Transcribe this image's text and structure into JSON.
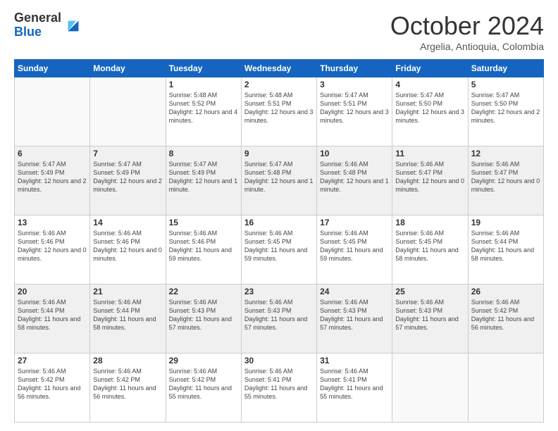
{
  "logo": {
    "line1": "General",
    "line2": "Blue"
  },
  "title": "October 2024",
  "subtitle": "Argelia, Antioquia, Colombia",
  "days_of_week": [
    "Sunday",
    "Monday",
    "Tuesday",
    "Wednesday",
    "Thursday",
    "Friday",
    "Saturday"
  ],
  "weeks": [
    [
      {
        "day": "",
        "info": ""
      },
      {
        "day": "",
        "info": ""
      },
      {
        "day": "1",
        "info": "Sunrise: 5:48 AM\nSunset: 5:52 PM\nDaylight: 12 hours and 4 minutes."
      },
      {
        "day": "2",
        "info": "Sunrise: 5:48 AM\nSunset: 5:51 PM\nDaylight: 12 hours and 3 minutes."
      },
      {
        "day": "3",
        "info": "Sunrise: 5:47 AM\nSunset: 5:51 PM\nDaylight: 12 hours and 3 minutes."
      },
      {
        "day": "4",
        "info": "Sunrise: 5:47 AM\nSunset: 5:50 PM\nDaylight: 12 hours and 3 minutes."
      },
      {
        "day": "5",
        "info": "Sunrise: 5:47 AM\nSunset: 5:50 PM\nDaylight: 12 hours and 2 minutes."
      }
    ],
    [
      {
        "day": "6",
        "info": "Sunrise: 5:47 AM\nSunset: 5:49 PM\nDaylight: 12 hours and 2 minutes."
      },
      {
        "day": "7",
        "info": "Sunrise: 5:47 AM\nSunset: 5:49 PM\nDaylight: 12 hours and 2 minutes."
      },
      {
        "day": "8",
        "info": "Sunrise: 5:47 AM\nSunset: 5:49 PM\nDaylight: 12 hours and 1 minute."
      },
      {
        "day": "9",
        "info": "Sunrise: 5:47 AM\nSunset: 5:48 PM\nDaylight: 12 hours and 1 minute."
      },
      {
        "day": "10",
        "info": "Sunrise: 5:46 AM\nSunset: 5:48 PM\nDaylight: 12 hours and 1 minute."
      },
      {
        "day": "11",
        "info": "Sunrise: 5:46 AM\nSunset: 5:47 PM\nDaylight: 12 hours and 0 minutes."
      },
      {
        "day": "12",
        "info": "Sunrise: 5:46 AM\nSunset: 5:47 PM\nDaylight: 12 hours and 0 minutes."
      }
    ],
    [
      {
        "day": "13",
        "info": "Sunrise: 5:46 AM\nSunset: 5:46 PM\nDaylight: 12 hours and 0 minutes."
      },
      {
        "day": "14",
        "info": "Sunrise: 5:46 AM\nSunset: 5:46 PM\nDaylight: 12 hours and 0 minutes."
      },
      {
        "day": "15",
        "info": "Sunrise: 5:46 AM\nSunset: 5:46 PM\nDaylight: 11 hours and 59 minutes."
      },
      {
        "day": "16",
        "info": "Sunrise: 5:46 AM\nSunset: 5:45 PM\nDaylight: 11 hours and 59 minutes."
      },
      {
        "day": "17",
        "info": "Sunrise: 5:46 AM\nSunset: 5:45 PM\nDaylight: 11 hours and 59 minutes."
      },
      {
        "day": "18",
        "info": "Sunrise: 5:46 AM\nSunset: 5:45 PM\nDaylight: 11 hours and 58 minutes."
      },
      {
        "day": "19",
        "info": "Sunrise: 5:46 AM\nSunset: 5:44 PM\nDaylight: 11 hours and 58 minutes."
      }
    ],
    [
      {
        "day": "20",
        "info": "Sunrise: 5:46 AM\nSunset: 5:44 PM\nDaylight: 11 hours and 58 minutes."
      },
      {
        "day": "21",
        "info": "Sunrise: 5:46 AM\nSunset: 5:44 PM\nDaylight: 11 hours and 58 minutes."
      },
      {
        "day": "22",
        "info": "Sunrise: 5:46 AM\nSunset: 5:43 PM\nDaylight: 11 hours and 57 minutes."
      },
      {
        "day": "23",
        "info": "Sunrise: 5:46 AM\nSunset: 5:43 PM\nDaylight: 11 hours and 57 minutes."
      },
      {
        "day": "24",
        "info": "Sunrise: 5:46 AM\nSunset: 5:43 PM\nDaylight: 11 hours and 57 minutes."
      },
      {
        "day": "25",
        "info": "Sunrise: 5:46 AM\nSunset: 5:43 PM\nDaylight: 11 hours and 57 minutes."
      },
      {
        "day": "26",
        "info": "Sunrise: 5:46 AM\nSunset: 5:42 PM\nDaylight: 11 hours and 56 minutes."
      }
    ],
    [
      {
        "day": "27",
        "info": "Sunrise: 5:46 AM\nSunset: 5:42 PM\nDaylight: 11 hours and 56 minutes."
      },
      {
        "day": "28",
        "info": "Sunrise: 5:46 AM\nSunset: 5:42 PM\nDaylight: 11 hours and 56 minutes."
      },
      {
        "day": "29",
        "info": "Sunrise: 5:46 AM\nSunset: 5:42 PM\nDaylight: 11 hours and 55 minutes."
      },
      {
        "day": "30",
        "info": "Sunrise: 5:46 AM\nSunset: 5:41 PM\nDaylight: 11 hours and 55 minutes."
      },
      {
        "day": "31",
        "info": "Sunrise: 5:46 AM\nSunset: 5:41 PM\nDaylight: 11 hours and 55 minutes."
      },
      {
        "day": "",
        "info": ""
      },
      {
        "day": "",
        "info": ""
      }
    ]
  ]
}
